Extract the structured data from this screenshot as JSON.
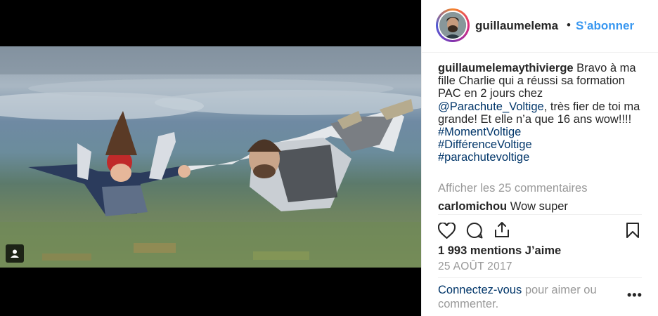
{
  "header": {
    "username": "guillaumelema",
    "separator": "•",
    "follow_label": "S’abonner"
  },
  "caption": {
    "username": "guillaumelemaythivierge",
    "text_part1": " Bravo à ma fille Charlie qui a réussi sa formation PAC en 2 jours chez ",
    "mention": "@Parachute_Voltige",
    "text_part2": ", très fier de toi ma grande! Et elle n’a que 16 ans wow!!!!",
    "hashtags": [
      "#MomentVoltige",
      "#DifférenceVoltige",
      "#parachutevoltige"
    ]
  },
  "comments": {
    "view_all_label": "Afficher les 25 commentaires",
    "items": [
      {
        "username": "carlomichou",
        "text": " Wow super"
      }
    ]
  },
  "actions": {
    "like_icon": "heart-icon",
    "comment_icon": "comment-icon",
    "share_icon": "share-icon",
    "save_icon": "bookmark-icon"
  },
  "likes_label": "1 993 mentions J’aime",
  "date_label": "25 AOÛT 2017",
  "login_prompt": {
    "link_label": "Connectez-vous",
    "rest_text": " pour aimer ou commenter."
  },
  "more_label": "•••",
  "colors": {
    "accent": "#3897f0",
    "link": "#003569",
    "muted": "#999999",
    "text": "#262626"
  }
}
